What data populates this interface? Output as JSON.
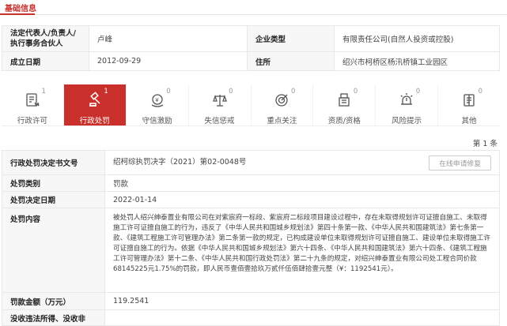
{
  "section": {
    "title": "基础信息"
  },
  "info": {
    "legal_rep_label": "法定代表人/负责人/执行事务合伙人",
    "legal_rep_value": "卢峰",
    "company_type_label": "企业类型",
    "company_type_value": "有限责任公司(自然人投资或控股)",
    "established_label": "成立日期",
    "established_value": "2012-09-29",
    "address_label": "住所",
    "address_value": "绍兴市柯桥区杨汛桥镇工业园区"
  },
  "categories": [
    {
      "label": "行政许可",
      "count": "1",
      "icon": "license-doc-icon",
      "active": false
    },
    {
      "label": "行政处罚",
      "count": "1",
      "icon": "gavel-icon",
      "active": true
    },
    {
      "label": "守信激励",
      "count": "0",
      "icon": "coin-incentive-icon",
      "active": false
    },
    {
      "label": "失信惩戒",
      "count": "0",
      "icon": "scales-icon",
      "active": false
    },
    {
      "label": "重点关注",
      "count": "0",
      "icon": "target-icon",
      "active": false
    },
    {
      "label": "资质/资格",
      "count": "0",
      "icon": "qualification-icon",
      "active": false
    },
    {
      "label": "风险提示",
      "count": "0",
      "icon": "warning-bell-icon",
      "active": false
    },
    {
      "label": "其他",
      "count": "0",
      "icon": "other-doc-icon",
      "active": false
    }
  ],
  "pagination": {
    "text": "第 1 条"
  },
  "detail": {
    "doc_no_label": "行政处罚决定书文号",
    "doc_no_value": "绍柯综执罚决字（2021）第02-0048号",
    "apply_button": "在线申请修复",
    "category_label": "处罚类别",
    "category_value": "罚款",
    "date_label": "处罚决定日期",
    "date_value": "2022-01-14",
    "content_label": "处罚内容",
    "content_value": "被处罚人绍兴绅泰置业有限公司在对紫宸府一标段、紫宸府二标段项目建设过程中，存在未取得规划许可证擅自施工、未取得施工许可证擅自施工的行为，违反了《中华人民共和国城乡规划法》第四十条第一款、《中华人民共和国建筑法》第七条第一款、《建筑工程施工许可管理办法》第二条第一款的规定，已构成建设单位未取得规划许可证擅自施工、建设单位未取得施工许可证擅自施工的行为。依据《中华人民共和国城乡规划法》第六十四条、《中华人民共和国建筑法》第六十四条、《建筑工程施工许可管理办法》第十二条、《中华人民共和国行政处罚法》第二十九条的规定，对绍兴绅泰置业有限公司处工程合同价款68145225元1.75%的罚款，即人民币壹佰壹拾玖万贰仟伍佰肆拾壹元整（¥：1192541元）。",
    "amount_label": "罚款金额（万元）",
    "amount_value": "119.2541",
    "next_label": "没收违法所得、没收非"
  }
}
